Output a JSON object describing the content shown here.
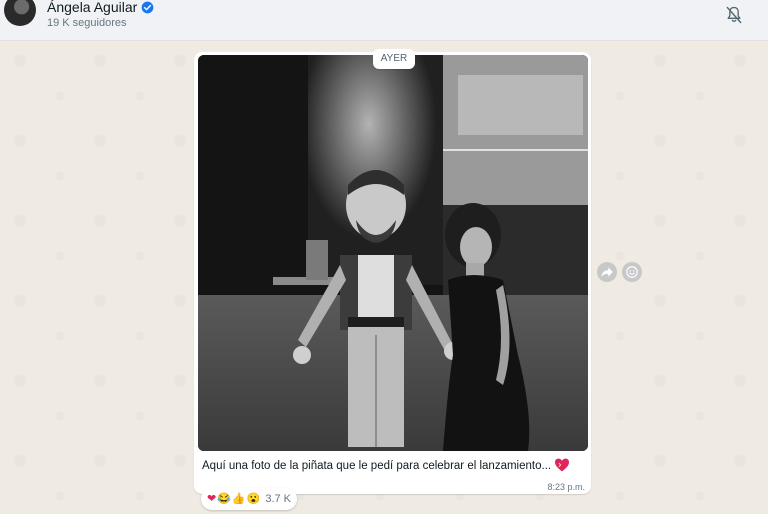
{
  "header": {
    "channel_name": "Ángela Aguilar",
    "followers": "19 K seguidores"
  },
  "message": {
    "day_label": "AYER",
    "caption": "Aquí una foto de la piñata que le pedí para celebrar el lanzamiento...",
    "time": "8:23 p.m."
  },
  "reactions": {
    "emojis": [
      "❤",
      "😂",
      "👍",
      "😮"
    ],
    "count": "3.7 K"
  },
  "colors": {
    "background": "#efeae2",
    "header": "#f0f2f5",
    "verified": "#1877f2",
    "heart": "#e0245e"
  },
  "icons": {
    "mute": "bell-off-icon",
    "verified": "verified-badge-icon",
    "forward": "forward-icon",
    "emoji": "emoji-smile-icon"
  }
}
